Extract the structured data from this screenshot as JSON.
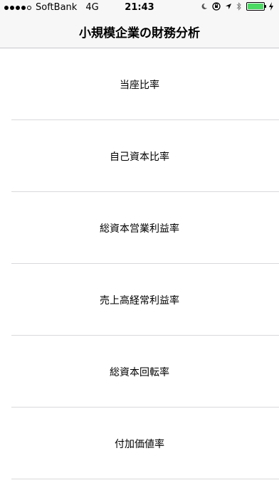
{
  "status_bar": {
    "carrier": "SoftBank",
    "network": "4G",
    "time": "21:43",
    "signal_bars_filled": 4,
    "signal_bars_total": 5,
    "battery_color": "#4cd964"
  },
  "nav": {
    "title": "小規模企業の財務分析"
  },
  "list": {
    "items": [
      {
        "label": "当座比率"
      },
      {
        "label": "自己資本比率"
      },
      {
        "label": "総資本営業利益率"
      },
      {
        "label": "売上高経常利益率"
      },
      {
        "label": "総資本回転率"
      },
      {
        "label": "付加価値率"
      }
    ]
  }
}
